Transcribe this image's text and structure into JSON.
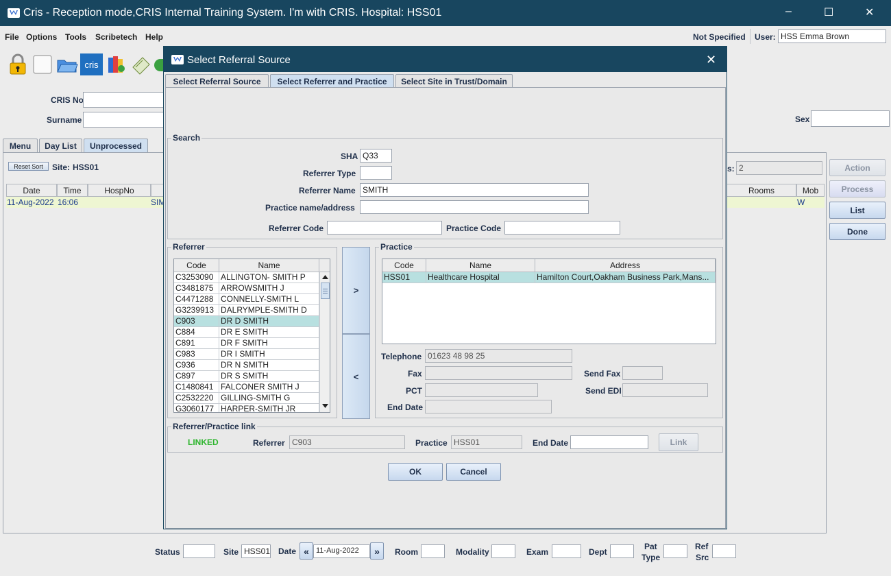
{
  "window": {
    "title": "Cris - Reception mode,CRIS Internal Training System. I'm with CRIS.   Hospital: HSS01",
    "controls": {
      "minimize": "–",
      "maximize": "☐",
      "close": "✕"
    }
  },
  "menu": [
    "File",
    "Options",
    "Tools",
    "Scribetech",
    "Help"
  ],
  "header": {
    "not_specified": "Not Specified",
    "user_label": "User:",
    "user_value": "HSS Emma Brown"
  },
  "toolbar": {
    "cris_label": "cris"
  },
  "patient": {
    "cris_no_label": "CRIS No",
    "surname_label": "Surname",
    "sex_label": "Sex"
  },
  "tabs": [
    "Menu",
    "Day List",
    "Unprocessed"
  ],
  "list": {
    "reset_sort": "Reset Sort",
    "site_label": "Site:",
    "site_value": "HSS01",
    "count_label": "s:",
    "count_value": "2",
    "columns": [
      "Date",
      "Time",
      "HospNo",
      "Rooms",
      "Mob"
    ],
    "row": {
      "date": "11-Aug-2022",
      "time": "16:06",
      "name_start": "SIM",
      "mob": "W"
    }
  },
  "side_buttons": {
    "action": "Action",
    "process": "Process",
    "list": "List",
    "done": "Done"
  },
  "footer": {
    "status": "Status",
    "site": "Site",
    "site_value": "HSS01",
    "date": "Date",
    "date_value": "11-Aug-2022",
    "room": "Room",
    "modality": "Modality",
    "exam": "Exam",
    "dept": "Dept",
    "pat": "Pat",
    "type": "Type",
    "ref": "Ref",
    "src": "Src"
  },
  "dialog": {
    "title": "Select Referral Source",
    "tabs": [
      "Select Referral Source",
      "Select Referrer and Practice",
      "Select Site in Trust/Domain"
    ],
    "search": {
      "group": "Search",
      "sha_label": "SHA",
      "sha_value": "Q33",
      "referrer_type_label": "Referrer Type",
      "referrer_type_value": "",
      "referrer_name_label": "Referrer Name",
      "referrer_name_value": "SMITH",
      "practice_label": "Practice name/address",
      "practice_value": "",
      "referrer_code_label": "Referrer Code",
      "referrer_code_value": "",
      "practice_code_label": "Practice Code",
      "practice_code_value": ""
    },
    "referrer": {
      "group": "Referrer",
      "columns": [
        "Code",
        "Name"
      ],
      "rows": [
        {
          "code": "C3253090",
          "name": "ALLINGTON- SMITH P"
        },
        {
          "code": "C3481875",
          "name": "ARROWSMITH J"
        },
        {
          "code": "C4471288",
          "name": "CONNELLY-SMITH L"
        },
        {
          "code": "G3239913",
          "name": "DALRYMPLE-SMITH D"
        },
        {
          "code": "C903",
          "name": "DR D SMITH"
        },
        {
          "code": "C884",
          "name": "DR E SMITH"
        },
        {
          "code": "C891",
          "name": "DR F SMITH"
        },
        {
          "code": "C983",
          "name": "DR I SMITH"
        },
        {
          "code": "C936",
          "name": "DR N SMITH"
        },
        {
          "code": "C897",
          "name": "DR S SMITH"
        },
        {
          "code": "C1480841",
          "name": "FALCONER SMITH J"
        },
        {
          "code": "C2532220",
          "name": "GILLING-SMITH G"
        },
        {
          "code": "G3060177",
          "name": "HARPER-SMITH JR"
        }
      ],
      "selected_index": 4
    },
    "move": {
      "right": ">",
      "left": "<"
    },
    "practice": {
      "group": "Practice",
      "columns": [
        "Code",
        "Name",
        "Address"
      ],
      "rows": [
        {
          "code": "HSS01",
          "name": "Healthcare Hospital",
          "address": "Hamilton Court,Oakham Business Park,Mans..."
        }
      ],
      "telephone_label": "Telephone",
      "telephone_value": "01623 48 98 25",
      "fax_label": "Fax",
      "fax_value": "",
      "send_fax_label": "Send Fax",
      "send_fax_value": "",
      "pct_label": "PCT",
      "pct_value": "",
      "send_edi_label": "Send EDI",
      "send_edi_value": "",
      "end_date_label": "End Date",
      "end_date_value": ""
    },
    "link": {
      "group": "Referrer/Practice link",
      "status": "LINKED",
      "referrer_label": "Referrer",
      "referrer_value": "C903",
      "practice_label": "Practice",
      "practice_value": "HSS01",
      "end_date_label": "End Date",
      "end_date_value": "",
      "link_button": "Link"
    },
    "ok": "OK",
    "cancel": "Cancel"
  }
}
